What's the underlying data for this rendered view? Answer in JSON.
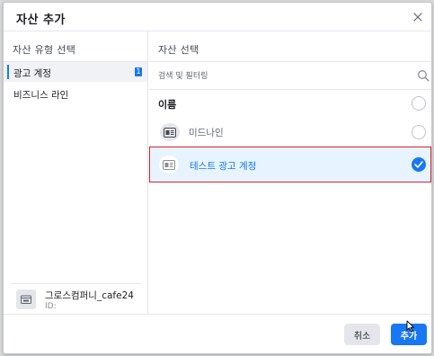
{
  "dialog": {
    "title": "자산 추가",
    "close_icon": "close-icon"
  },
  "left_panel": {
    "header": "자산 유형 선택",
    "items": [
      {
        "label": "광고 계정",
        "count": "1",
        "selected": true
      },
      {
        "label": "비즈니스 라인",
        "selected": false
      }
    ],
    "business": {
      "name": "그로스컴퍼니_cafe24",
      "id_label": "ID:",
      "icon": "business-icon"
    }
  },
  "right_panel": {
    "header": "자산 선택",
    "search": {
      "placeholder": "검색 및 필터링",
      "value": "",
      "icon": "search-icon"
    },
    "name_column": "이름",
    "rows": [
      {
        "label": "미드나인",
        "icon": "ad-account-icon",
        "selected": false
      },
      {
        "label": "테스트 광고 계정",
        "icon": "ad-account-icon",
        "selected": true
      }
    ]
  },
  "footer": {
    "cancel_label": "취소",
    "add_label": "추가"
  },
  "colors": {
    "accent": "#1877f2",
    "selected_row_bg": "#e7f3ff",
    "highlight_border": "#d9232e",
    "border": "#e4e6eb"
  }
}
